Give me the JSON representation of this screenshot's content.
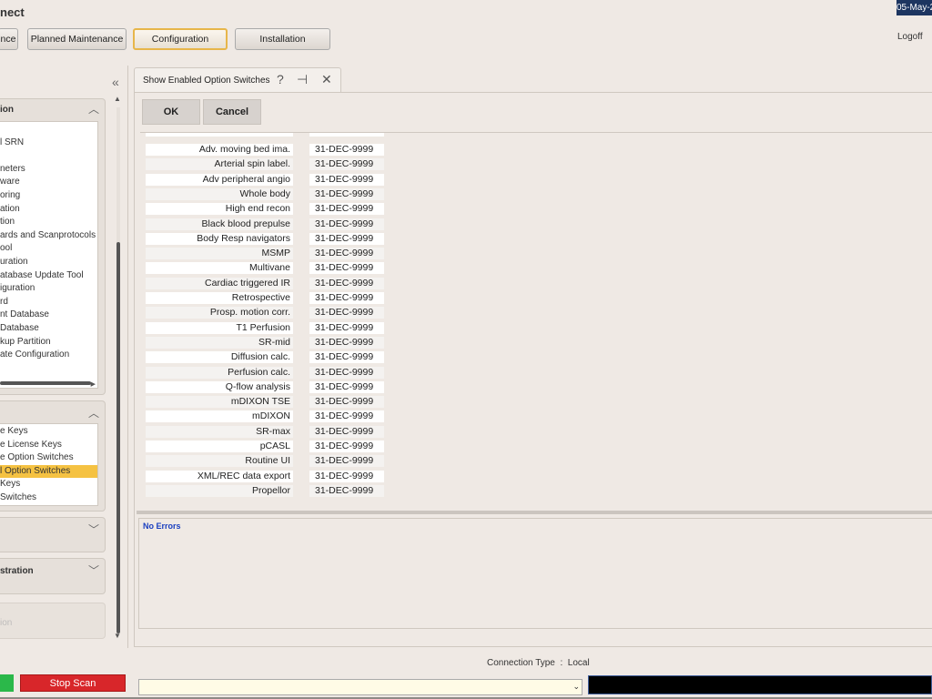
{
  "header": {
    "app_title": "nect",
    "date": "05-May-2",
    "logoff": "Logoff",
    "tabs": [
      "nce",
      "Planned Maintenance",
      "Configuration",
      "Installation"
    ]
  },
  "left_panel": {
    "section1": {
      "title": "ion",
      "items": [
        "",
        "l SRN",
        "",
        "neters",
        "ware",
        "oring",
        "ation",
        "tion",
        "ards and Scanprotocols",
        "ool",
        "uration",
        "atabase Update Tool",
        "iguration",
        "rd",
        "nt Database",
        " Database",
        "kup Partition",
        "ate Configuration"
      ]
    },
    "section2": {
      "items": [
        "e Keys",
        "e License Keys",
        "e Option Switches",
        "l Option Switches",
        "Keys",
        "Switches"
      ],
      "selected_index": 3
    },
    "section3": {
      "title": ""
    },
    "section4": {
      "title": "stration"
    },
    "section5": {
      "title": "ion"
    }
  },
  "tab": {
    "label": "Show Enabled Option Switches"
  },
  "dialog": {
    "ok_label": "OK",
    "cancel_label": "Cancel"
  },
  "options": [
    {
      "name": "Adv. moving bed ima.",
      "date": "31-DEC-9999"
    },
    {
      "name": "Arterial spin label.",
      "date": "31-DEC-9999"
    },
    {
      "name": "Adv peripheral angio",
      "date": "31-DEC-9999"
    },
    {
      "name": "Whole body",
      "date": "31-DEC-9999"
    },
    {
      "name": "High end recon",
      "date": "31-DEC-9999"
    },
    {
      "name": "Black blood prepulse",
      "date": "31-DEC-9999"
    },
    {
      "name": "Body Resp navigators",
      "date": "31-DEC-9999"
    },
    {
      "name": "MSMP",
      "date": "31-DEC-9999"
    },
    {
      "name": "Multivane",
      "date": "31-DEC-9999"
    },
    {
      "name": "Cardiac triggered IR",
      "date": "31-DEC-9999"
    },
    {
      "name": "Retrospective",
      "date": "31-DEC-9999"
    },
    {
      "name": "Prosp. motion corr.",
      "date": "31-DEC-9999"
    },
    {
      "name": "T1 Perfusion",
      "date": "31-DEC-9999"
    },
    {
      "name": "SR-mid",
      "date": "31-DEC-9999"
    },
    {
      "name": "Diffusion calc.",
      "date": "31-DEC-9999"
    },
    {
      "name": "Perfusion calc.",
      "date": "31-DEC-9999"
    },
    {
      "name": "Q-flow analysis",
      "date": "31-DEC-9999"
    },
    {
      "name": "mDIXON TSE",
      "date": "31-DEC-9999"
    },
    {
      "name": "mDIXON",
      "date": "31-DEC-9999"
    },
    {
      "name": "SR-max",
      "date": "31-DEC-9999"
    },
    {
      "name": "pCASL",
      "date": "31-DEC-9999"
    },
    {
      "name": "Routine UI",
      "date": "31-DEC-9999"
    },
    {
      "name": "XML/REC data export",
      "date": "31-DEC-9999"
    },
    {
      "name": "Propellor",
      "date": "31-DEC-9999"
    }
  ],
  "status": {
    "text": "No Errors"
  },
  "footer": {
    "connection_label": "Connection Type",
    "connection_sep": ":",
    "connection_value": "Local",
    "stop_scan_label": "Stop Scan"
  }
}
